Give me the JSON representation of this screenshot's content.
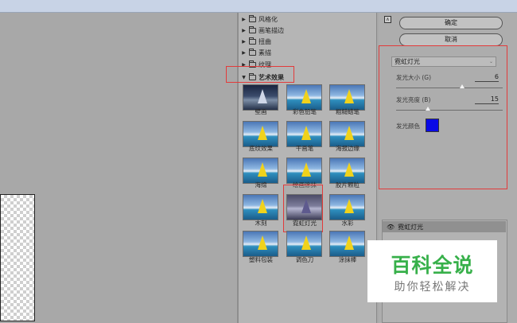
{
  "gallery": {
    "categories": [
      "风格化",
      "画笔描边",
      "扭曲",
      "素描",
      "纹理",
      "艺术效果"
    ],
    "artistic_filters": [
      "壁画",
      "彩色铅笔",
      "粗糙蜡笔",
      "底纹效果",
      "干画笔",
      "海报边缘",
      "海绵",
      "绘画涂抹",
      "胶片颗粒",
      "木刻",
      "霓虹灯光",
      "水彩",
      "塑料包装",
      "调色刀",
      "涂抹棒"
    ],
    "selected_filter": "霓虹灯光"
  },
  "buttons": {
    "ok": "确定",
    "cancel": "取消",
    "collapse": "∧"
  },
  "settings": {
    "filter_name": "霓虹灯光",
    "glow_size_label": "发光大小 (G)",
    "glow_size_value": "6",
    "glow_size_fraction": 0.62,
    "glow_brightness_label": "发光亮度 (B)",
    "glow_brightness_value": "15",
    "glow_brightness_fraction": 0.3,
    "glow_color_label": "发光颜色",
    "glow_color": "#0a0ae6"
  },
  "layers": {
    "active_layer": "霓虹灯光"
  },
  "watermark": {
    "title": "百科全说",
    "subtitle": "助你轻松解决"
  },
  "colors": {
    "highlight": "#e23b3b",
    "watermark_green": "#37b04a"
  }
}
